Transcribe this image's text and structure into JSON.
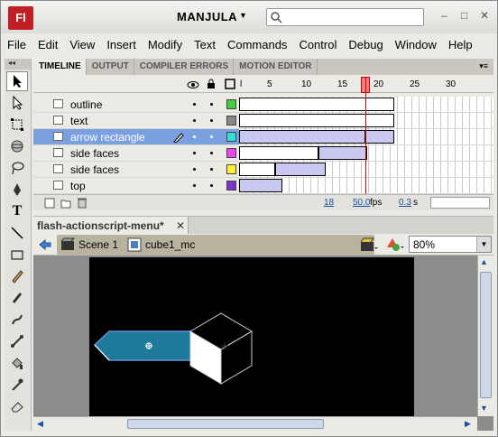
{
  "app": {
    "logo": "Fl",
    "workspace": "MANJULA",
    "search_placeholder": ""
  },
  "window_controls": [
    "–",
    "□",
    "✕"
  ],
  "menu": [
    "File",
    "Edit",
    "View",
    "Insert",
    "Modify",
    "Text",
    "Commands",
    "Control",
    "Debug",
    "Window",
    "Help"
  ],
  "panel_tabs": [
    "TIMELINE",
    "OUTPUT",
    "COMPILER ERRORS",
    "MOTION EDITOR"
  ],
  "frame_ruler": [
    "l",
    "5",
    "10",
    "15",
    "20",
    "25",
    "30"
  ],
  "layers": [
    {
      "name": "outline",
      "color": "#44cc44"
    },
    {
      "name": "text",
      "color": "#888888"
    },
    {
      "name": "arrow rectangle",
      "color": "#33dddd",
      "selected": true
    },
    {
      "name": "side faces",
      "color": "#ee44ee"
    },
    {
      "name": "side faces",
      "color": "#ffee33"
    },
    {
      "name": "top",
      "color": "#7a33cc"
    }
  ],
  "timeline_footer": {
    "current_frame": "18",
    "fps": "50.0",
    "fps_unit": "fps",
    "time": "0.3",
    "time_unit": "s"
  },
  "document": {
    "tab_label": "flash-actionscript-menu*",
    "close": "✕"
  },
  "breadcrumb": {
    "scene": "Scene 1",
    "symbol": "cube1_mc"
  },
  "zoom": {
    "value": "80%"
  }
}
